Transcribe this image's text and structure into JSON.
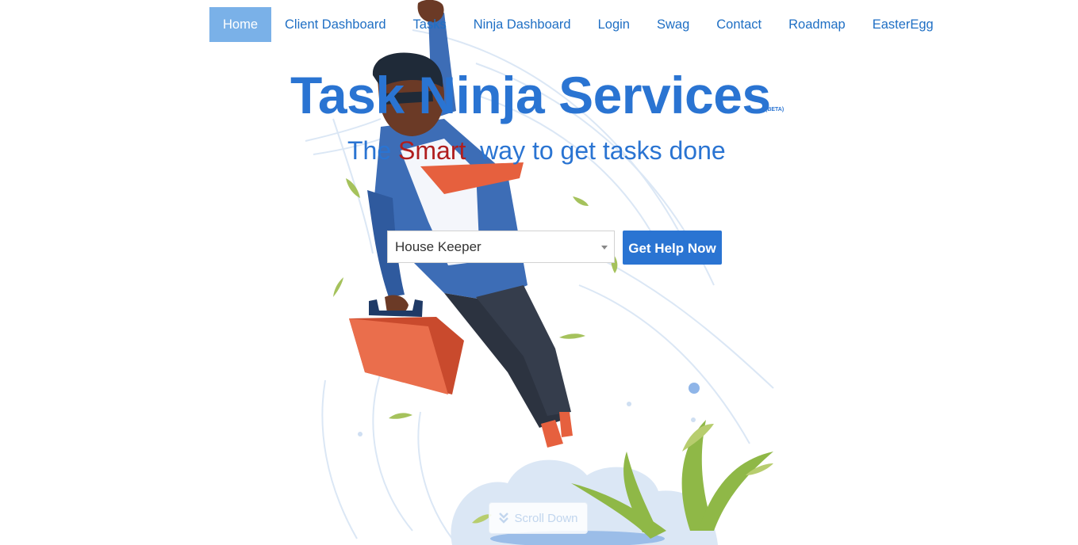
{
  "nav": {
    "items": [
      {
        "label": "Home",
        "active": true
      },
      {
        "label": "Client Dashboard"
      },
      {
        "label": "Tasks"
      },
      {
        "label": "Ninja Dashboard"
      },
      {
        "label": "Login"
      },
      {
        "label": "Swag"
      },
      {
        "label": "Contact"
      },
      {
        "label": "Roadmap"
      },
      {
        "label": "EasterEgg"
      }
    ]
  },
  "hero": {
    "title": "Task Ninja Services",
    "badge": "(BETA)",
    "tagline_pre": "The ",
    "tagline_highlight": "Smart",
    "tagline_post": "  way to get tasks done"
  },
  "search": {
    "selected": "House Keeper",
    "button_label": "Get Help Now"
  },
  "scroll": {
    "label": "Scroll Down",
    "icon": "double-chevron-down-icon"
  },
  "colors": {
    "primary": "#2a74d2",
    "nav_active_bg": "#7ab1e8",
    "highlight": "#b01e1e"
  }
}
